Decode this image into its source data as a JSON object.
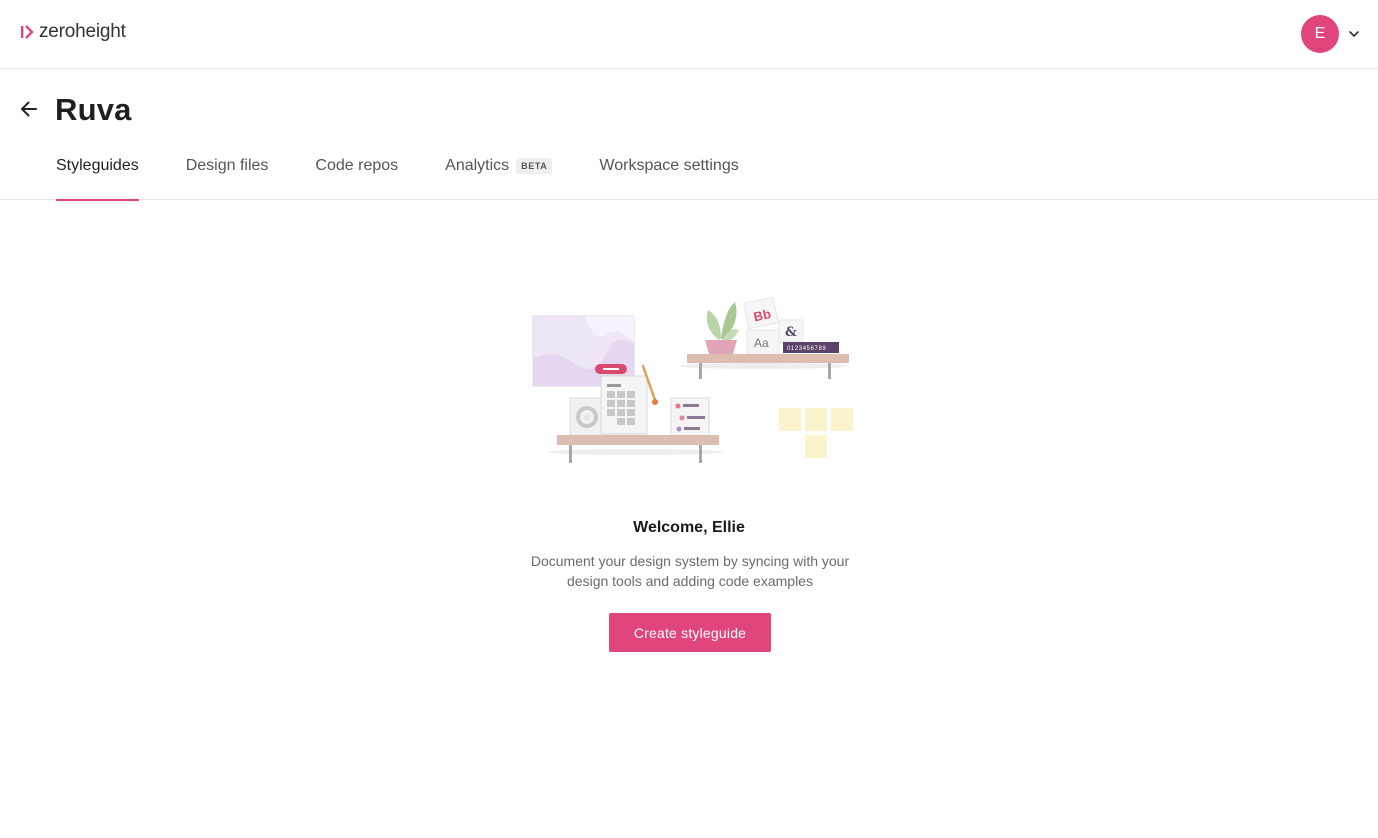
{
  "brand": {
    "name": "zeroheight",
    "accent_color": "#e0457b",
    "logo_icon": "zeroheight-logo-icon"
  },
  "user_menu": {
    "avatar_initial": "E",
    "avatar_color": "#e0457b",
    "menu_icon": "chevron-down-icon"
  },
  "header": {
    "back_icon": "arrow-left-icon",
    "title": "Ruva"
  },
  "tabs": [
    {
      "label": "Styleguides",
      "active": true
    },
    {
      "label": "Design files",
      "active": false
    },
    {
      "label": "Code repos",
      "active": false
    },
    {
      "label": "Analytics",
      "badge": "BETA",
      "active": false
    },
    {
      "label": "Workspace settings",
      "active": false
    }
  ],
  "empty_state": {
    "illustration": "design-shelves-illustration",
    "illustration_texts": {
      "bb": "Bb",
      "aa": "Aa",
      "amp": "&",
      "digits": "0123456789"
    },
    "title": "Welcome, Ellie",
    "description": "Document your design system by syncing with your design tools and adding code examples",
    "cta_label": "Create styleguide"
  }
}
